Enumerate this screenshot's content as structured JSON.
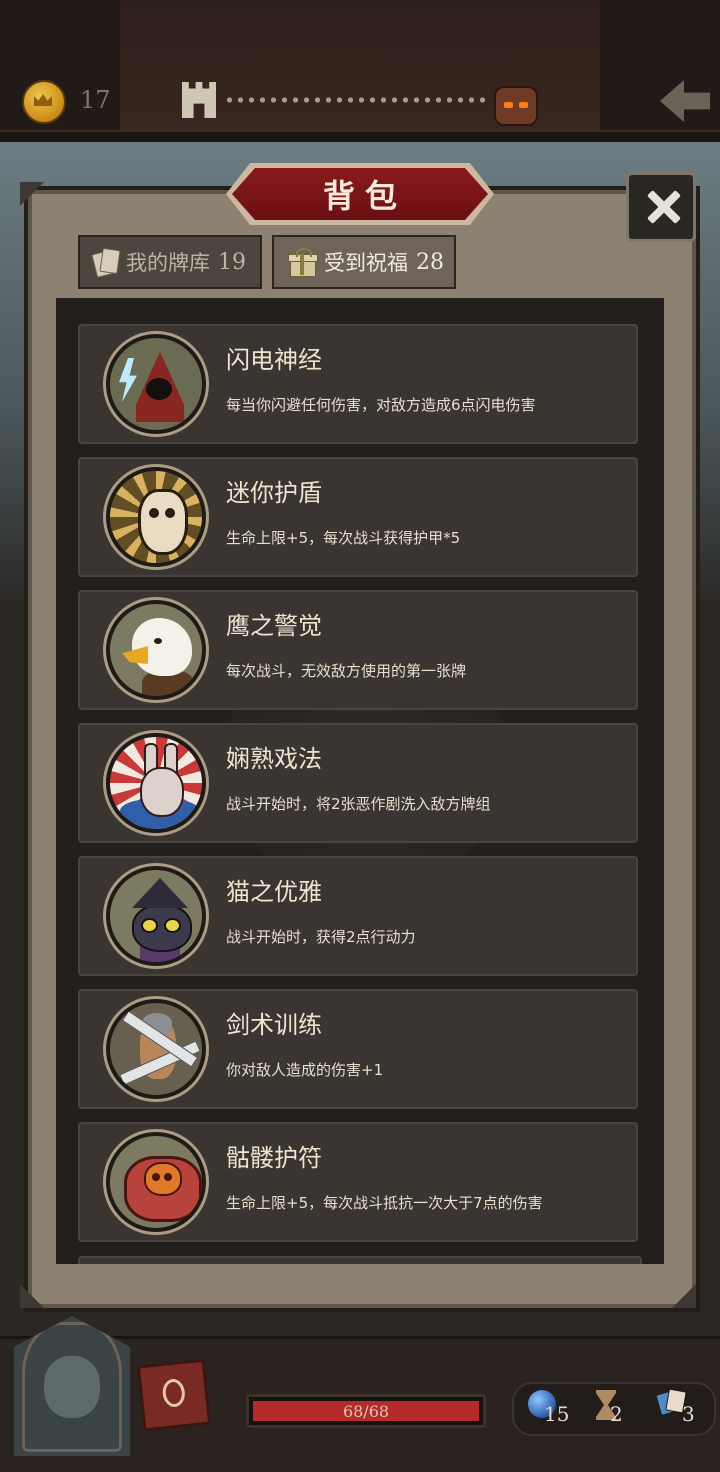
{
  "header": {
    "coins": "17",
    "icons": {
      "coin": "crown-coin-icon",
      "tower": "tower-icon",
      "boss": "demon-boss-icon",
      "back": "back-arrow-icon"
    }
  },
  "dialog": {
    "title": "背包",
    "close_icon": "close-icon",
    "tabs": [
      {
        "label": "我的牌库",
        "count": "19",
        "icon": "cards-icon",
        "active": false
      },
      {
        "label": "受到祝福",
        "count": "28",
        "icon": "gift-icon",
        "active": true
      }
    ],
    "items": [
      {
        "name": "闪电神经",
        "desc": "每当你闪避任何伤害，对敌方造成6点闪电伤害",
        "icon": "lightning-hooded-figure-icon"
      },
      {
        "name": "迷你护盾",
        "desc": "生命上限+5，每次战斗获得护甲*5",
        "icon": "skull-shield-icon"
      },
      {
        "name": "鹰之警觉",
        "desc": "每次战斗，无效敌方使用的第一张牌",
        "icon": "eagle-icon"
      },
      {
        "name": "娴熟戏法",
        "desc": "战斗开始时，将2张恶作剧洗入敌方牌组",
        "icon": "magician-rabbit-icon"
      },
      {
        "name": "猫之优雅",
        "desc": "战斗开始时，获得2点行动力",
        "icon": "witch-cat-icon"
      },
      {
        "name": "剑术训练",
        "desc": "你对敌人造成的伤害+1",
        "icon": "swordsman-icon"
      },
      {
        "name": "骷髅护符",
        "desc": "生命上限+5，每次战斗抵抗一次大于7点的伤害",
        "icon": "skull-charm-icon"
      }
    ]
  },
  "footer": {
    "hp_text": "68/68",
    "hp_fraction": 1.0,
    "mana": "15",
    "turns": "2",
    "cards": "3",
    "icons": {
      "portrait": "hero-portrait",
      "book": "spellbook-icon",
      "mana": "mana-orb-icon",
      "turns": "hourglass-icon",
      "cards": "card-stack-icon"
    }
  },
  "colors": {
    "accent_red": "#8a1a1c",
    "hp_red": "#b52a2a",
    "panel": "#8d8271"
  }
}
